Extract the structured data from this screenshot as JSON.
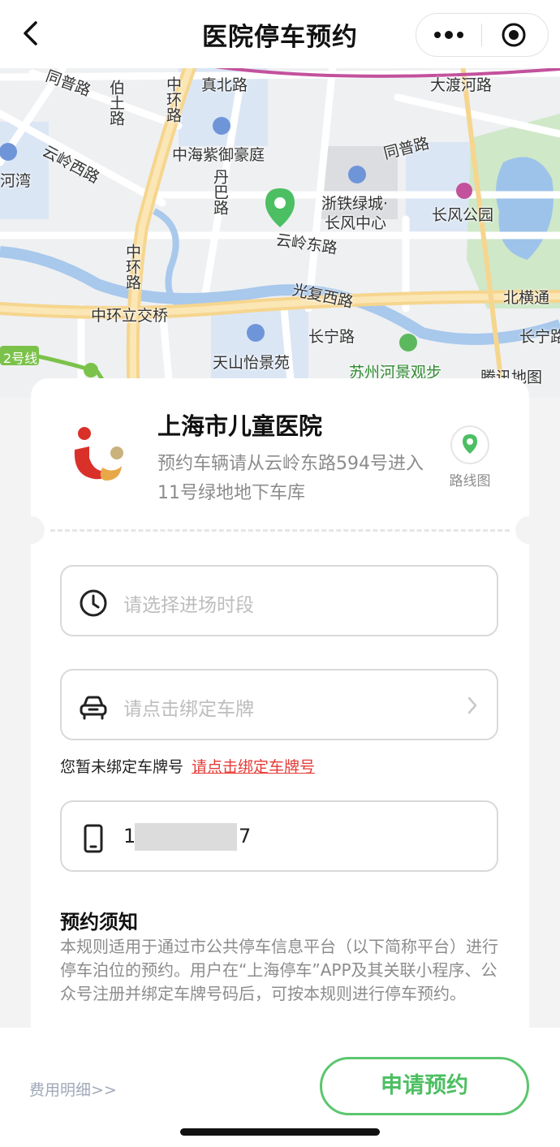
{
  "nav": {
    "title": "医院停车预约"
  },
  "map": {
    "labels": {
      "tongpu": "同普路",
      "bai": "伯土路",
      "zhonghuan1": "中环路",
      "zhenbei": "真北路",
      "dadu": "大渡河路",
      "haiyu": "中海紫御豪庭",
      "yunling_w": "云岭西路",
      "hewan": "河湾",
      "danba": "丹巴路",
      "zhetie": "浙铁绿城·",
      "changfeng_c": "长风中心",
      "tongpu2": "同普路",
      "changfeng_p": "长风公园",
      "yunling_e": "云岭东路",
      "zhonghuan2": "中环路",
      "guangfu": "光复西路",
      "beiheng": "北横通",
      "zhonghuan_bridge": "中环立交桥",
      "changning": "长宁路",
      "changning2": "长宁路",
      "tianshan": "天山怡景苑",
      "line2": "2号线",
      "suzhou": "苏州河景观步",
      "tencent": "腾讯地图"
    }
  },
  "hospital": {
    "name": "上海市儿童医院",
    "desc": "预约车辆请从云岭东路594号进入11号绿地地下车库",
    "route_label": "路线图"
  },
  "form": {
    "time_placeholder": "请选择进场时段",
    "plate_placeholder": "请点击绑定车牌",
    "plate_hint": "您暂未绑定车牌号",
    "plate_hint_link": "请点击绑定车牌号",
    "phone_start": "1",
    "phone_end": "7"
  },
  "notice": {
    "title": "预约须知",
    "body": "本规则适用于通过市公共停车信息平台（以下简称平台）进行停车泊位的预约。用户在“上海停车”APP及其关联小程序、公众号注册并绑定车牌号码后，可按本规则进行停车预约。"
  },
  "bottom": {
    "fee_label": "费用明细>>",
    "apply_label": "申请预约"
  },
  "colors": {
    "accent": "#4cbf62",
    "link": "#e53935"
  }
}
